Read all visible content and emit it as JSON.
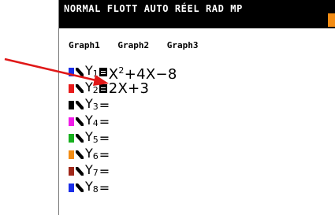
{
  "status_bar": {
    "text": "NORMAL FLOTT AUTO RÉEL RAD MP",
    "battery_color": "#f28c14"
  },
  "graph_tabs": [
    "Graph1",
    "Graph2",
    "Graph3"
  ],
  "equations": [
    {
      "label": "1",
      "expr_base": "X",
      "expr_exp": "2",
      "expr_rest": "+4X−8",
      "color": "#1a2ee8"
    },
    {
      "label": "2",
      "expr_base": "2X+3",
      "expr_exp": "",
      "expr_rest": "",
      "color": "#e81a1a"
    },
    {
      "label": "3",
      "color": "#000000"
    },
    {
      "label": "4",
      "color": "#f01ce8"
    },
    {
      "label": "5",
      "color": "#17b01e"
    },
    {
      "label": "6",
      "color": "#f28c14"
    },
    {
      "label": "7",
      "color": "#a0281a"
    },
    {
      "label": "8",
      "color": "#1a2ee8"
    }
  ],
  "annotation_arrow_color": "#e01818"
}
